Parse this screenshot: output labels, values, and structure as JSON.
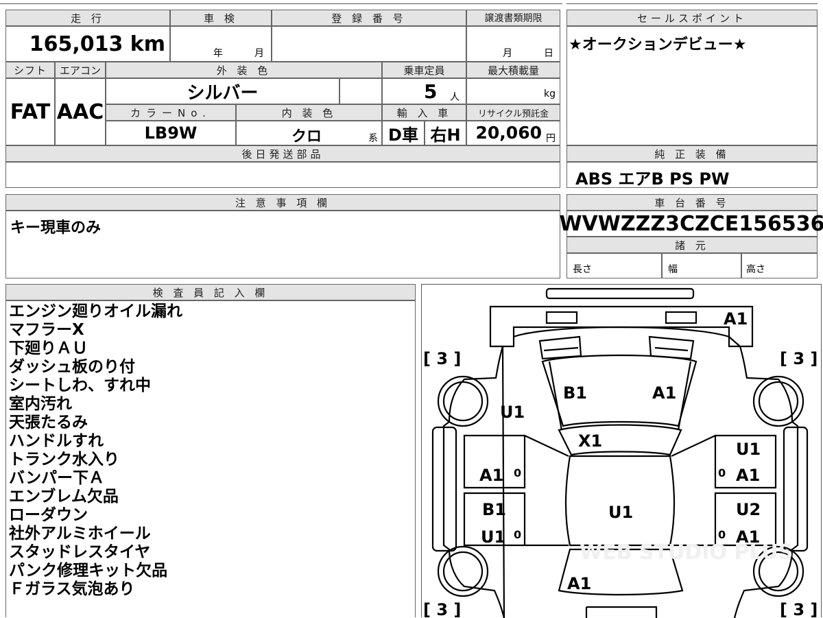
{
  "header": {
    "mileage_label": "走 行",
    "shaken_label": "車 検",
    "registration_label": "登 録 番 号",
    "transfer_deadline_label": "譲渡書類期限",
    "sales_point_label": "セールスポイント"
  },
  "mileage": "165,013 km",
  "shaken": {
    "year_unit": "年",
    "month_unit": "月"
  },
  "transfer_deadline": {
    "month_unit": "月",
    "day_unit": "日"
  },
  "sales_point": "★オークションデビュー★",
  "row2_labels": {
    "shift": "シフト",
    "aircon": "エアコン",
    "exterior_color": "外 装 色",
    "capacity": "乗車定員",
    "max_load": "最大積載量"
  },
  "shift": "FAT",
  "aircon": "AAC",
  "exterior_color": "シルバー",
  "capacity": {
    "value": "5",
    "unit": "人"
  },
  "max_load_unit": "kg",
  "row3_labels": {
    "color_no": "カラーNo.",
    "interior_color": "内 装 色",
    "import": "輸 入 車",
    "recycle": "リサイクル預託金"
  },
  "color_no": "LB9W",
  "interior_color": {
    "value": "クロ",
    "suffix": "系"
  },
  "import": {
    "type": "D車",
    "handle": "右H"
  },
  "recycle": {
    "value": "20,060",
    "unit": "円"
  },
  "later_parts_label": "後日発送部品",
  "genuine_equipment_label": "純 正 装 備",
  "genuine_equipment": "ABS エアB PS PW",
  "notes_label": "注 意 事 項 欄",
  "notes": "キー現車のみ",
  "chassis_label": "車 台 番 号",
  "chassis_number": "WVWZZZ3CZCE156536",
  "specs_label": "諸 元",
  "specs": {
    "length": "長さ",
    "width": "幅",
    "height": "高さ"
  },
  "inspector_label": "検 査 員 記 入 欄",
  "inspector_notes": [
    "エンジン廻りオイル漏れ",
    "マフラーX",
    "下廻りＡＵ",
    "ダッシュ板のり付",
    "シートしわ、すれ中",
    "室内汚れ",
    "天張たるみ",
    "ハンドルすれ",
    "トランク水入り",
    "バンパー下Ａ",
    "エンブレム欠品",
    "ローダウン",
    "社外アルミホイール",
    "スタッドレスタイヤ",
    "パンク修理キット欠品",
    "Ｆガラス気泡あり"
  ],
  "diagram": {
    "tires": {
      "front_left": "[ 3 ]",
      "front_right": "[ 3 ]",
      "rear_left": "[ 3 ]",
      "rear_right": "[ 3 ]"
    },
    "marks": {
      "front_bumper": "A1",
      "hood_left": "B1",
      "hood_right": "A1",
      "left_fender": "U1",
      "windshield": "X1",
      "right_fender": "U1",
      "left_front_door": "A1",
      "right_front_door": "A1",
      "left_rear_door_top": "B1",
      "left_rear_door_bottom": "U1",
      "roof": "U1",
      "right_rear_door_top": "U2",
      "right_rear_door_bottom": "A1",
      "rear_glass": "A1"
    },
    "zero_marks": "0",
    "watermark": "WEB STUDIO PLUS"
  }
}
